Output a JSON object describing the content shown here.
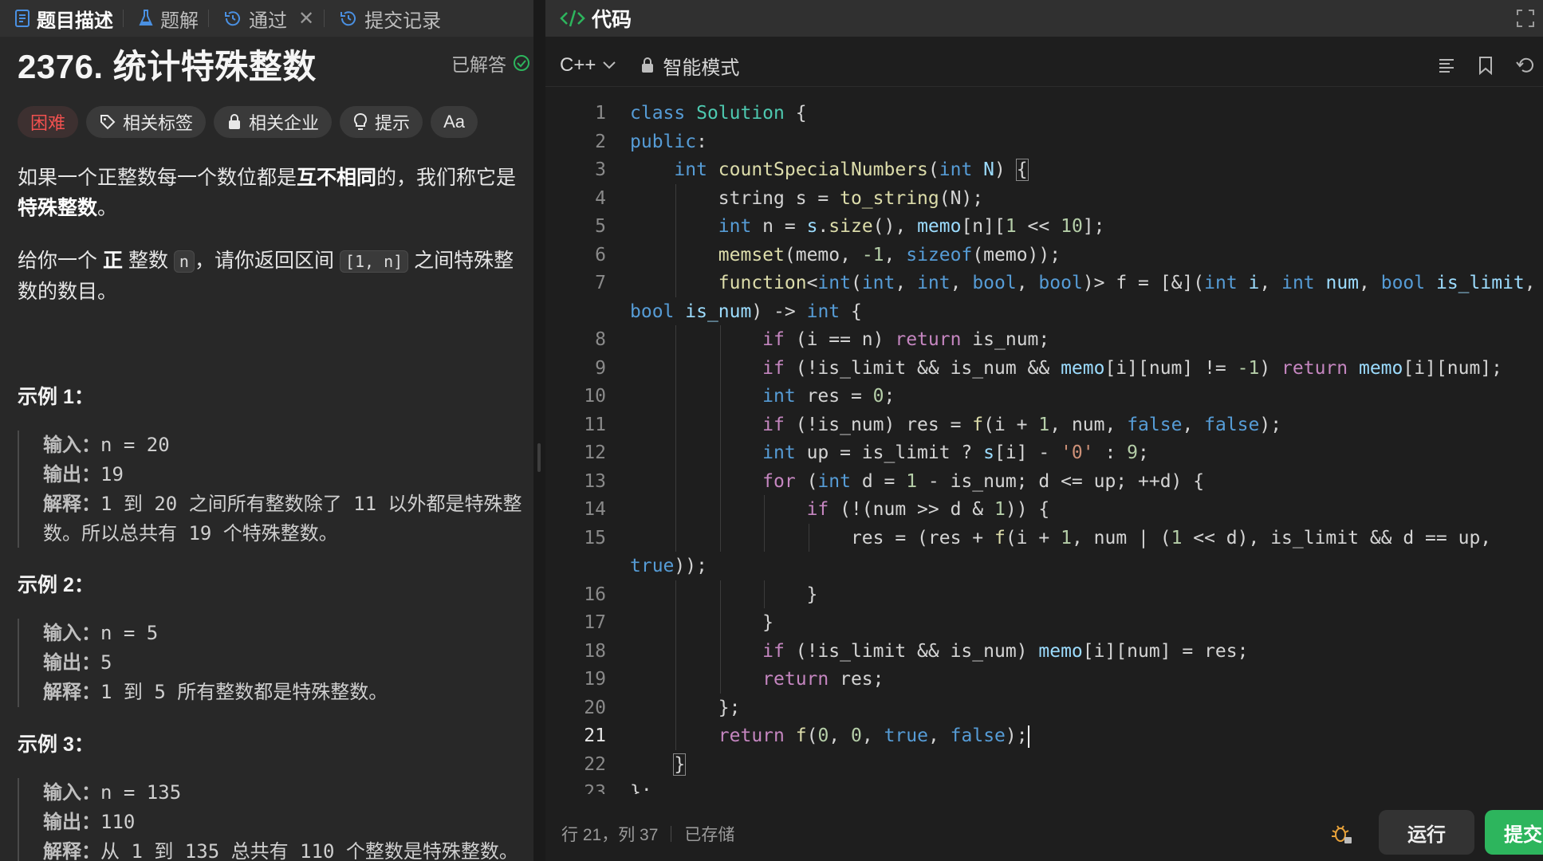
{
  "left_tabs": [
    {
      "label": "题目描述",
      "icon": "document-icon",
      "active": true
    },
    {
      "label": "题解",
      "icon": "flask-icon",
      "active": false
    },
    {
      "label": "通过",
      "icon": "history-icon",
      "active": false,
      "closable": true
    },
    {
      "label": "提交记录",
      "icon": "history-icon",
      "active": false
    }
  ],
  "problem": {
    "title": "2376. 统计特殊整数",
    "solved_label": "已解答",
    "difficulty": "困难",
    "chips": [
      "相关标签",
      "相关企业",
      "提示",
      "Aa"
    ],
    "desc1_a": "如果一个正整数每一个数位都是",
    "desc1_b": "互不相同",
    "desc1_c": "的，我们称它是",
    "desc1_d": "特殊整数",
    "desc1_e": "。",
    "desc2_a": "给你一个",
    "desc2_b": "正",
    "desc2_c": "整数",
    "desc2_n": "n",
    "desc2_d": "，请你返回区间",
    "desc2_range": "[1, n]",
    "desc2_e": "之间特殊整数的数目。"
  },
  "examples": [
    {
      "title": "示例 1：",
      "input_key": "输入：",
      "input": "n = 20",
      "output_key": "输出：",
      "output": "19",
      "expl_key": "解释：",
      "explanation": "1 到 20 之间所有整数除了 11 以外都是特殊整数。所以总共有 19 个特殊整数。"
    },
    {
      "title": "示例 2：",
      "input_key": "输入：",
      "input": "n = 5",
      "output_key": "输出：",
      "output": "5",
      "expl_key": "解释：",
      "explanation": "1 到 5 所有整数都是特殊整数。"
    },
    {
      "title": "示例 3：",
      "input_key": "输入：",
      "input": "n = 135",
      "output_key": "输出：",
      "output": "110",
      "expl_key": "解释：",
      "explanation": "从 1 到 135 总共有 110 个整数是特殊整数。"
    }
  ],
  "editor": {
    "tab_label": "代码",
    "language": "C++",
    "mode": "智能模式",
    "cursor_position": "行 21，列 37",
    "save_status": "已存储",
    "run_label": "运行",
    "submit_label": "提交"
  },
  "code_lines": [
    {
      "n": "1",
      "t": [
        [
          "kw",
          "class "
        ],
        [
          "cls",
          "Solution"
        ],
        [
          "pl",
          " {"
        ]
      ]
    },
    {
      "n": "2",
      "t": [
        [
          "kw",
          "public"
        ],
        [
          "pl",
          ":"
        ]
      ]
    },
    {
      "n": "3",
      "t": [
        [
          "pl",
          "    "
        ],
        [
          "kw",
          "int "
        ],
        [
          "fn",
          "countSpecialNumbers"
        ],
        [
          "pl",
          "("
        ],
        [
          "kw",
          "int "
        ],
        [
          "var",
          "N"
        ],
        [
          "pl",
          ") "
        ],
        [
          "hl",
          "{"
        ]
      ]
    },
    {
      "n": "4",
      "t": [
        [
          "pl",
          "        string s = "
        ],
        [
          "fn",
          "to_string"
        ],
        [
          "pl",
          "(N);"
        ]
      ]
    },
    {
      "n": "5",
      "t": [
        [
          "pl",
          "        "
        ],
        [
          "kw",
          "int "
        ],
        [
          "pl",
          "n = "
        ],
        [
          "var",
          "s"
        ],
        [
          "pl",
          "."
        ],
        [
          "fn",
          "size"
        ],
        [
          "pl",
          "(), "
        ],
        [
          "var",
          "memo"
        ],
        [
          "pl",
          "[n]["
        ],
        [
          "num",
          "1"
        ],
        [
          "pl",
          " << "
        ],
        [
          "num",
          "10"
        ],
        [
          "pl",
          "];"
        ]
      ]
    },
    {
      "n": "6",
      "t": [
        [
          "pl",
          "        "
        ],
        [
          "fn",
          "memset"
        ],
        [
          "pl",
          "(memo, "
        ],
        [
          "num",
          "-1"
        ],
        [
          "pl",
          ", "
        ],
        [
          "kw",
          "sizeof"
        ],
        [
          "pl",
          "(memo));"
        ]
      ]
    },
    {
      "n": "7",
      "t": [
        [
          "pl",
          "        "
        ],
        [
          "fn",
          "function"
        ],
        [
          "pl",
          "<"
        ],
        [
          "kw",
          "int"
        ],
        [
          "pl",
          "("
        ],
        [
          "kw",
          "int"
        ],
        [
          "pl",
          ", "
        ],
        [
          "kw",
          "int"
        ],
        [
          "pl",
          ", "
        ],
        [
          "kw",
          "bool"
        ],
        [
          "pl",
          ", "
        ],
        [
          "kw",
          "bool"
        ],
        [
          "pl",
          ")> f = [&]("
        ],
        [
          "kw",
          "int "
        ],
        [
          "var",
          "i"
        ],
        [
          "pl",
          ", "
        ],
        [
          "kw",
          "int "
        ],
        [
          "var",
          "num"
        ],
        [
          "pl",
          ", "
        ],
        [
          "kw",
          "bool "
        ],
        [
          "var",
          "is_limit"
        ],
        [
          "pl",
          ","
        ]
      ]
    },
    {
      "n": "",
      "t": [
        [
          "kw",
          "bool "
        ],
        [
          "var",
          "is_num"
        ],
        [
          "pl",
          ") -> "
        ],
        [
          "kw",
          "int"
        ],
        [
          "pl",
          " {"
        ]
      ]
    },
    {
      "n": "8",
      "t": [
        [
          "pl",
          "            "
        ],
        [
          "ctl",
          "if"
        ],
        [
          "pl",
          " (i == n) "
        ],
        [
          "ctl",
          "return"
        ],
        [
          "pl",
          " is_num;"
        ]
      ]
    },
    {
      "n": "9",
      "t": [
        [
          "pl",
          "            "
        ],
        [
          "ctl",
          "if"
        ],
        [
          "pl",
          " (!is_limit && is_num && "
        ],
        [
          "var",
          "memo"
        ],
        [
          "pl",
          "[i][num] != "
        ],
        [
          "num",
          "-1"
        ],
        [
          "pl",
          ") "
        ],
        [
          "ctl",
          "return "
        ],
        [
          "var",
          "memo"
        ],
        [
          "pl",
          "[i][num];"
        ]
      ]
    },
    {
      "n": "10",
      "t": [
        [
          "pl",
          "            "
        ],
        [
          "kw",
          "int "
        ],
        [
          "pl",
          "res = "
        ],
        [
          "num",
          "0"
        ],
        [
          "pl",
          ";"
        ]
      ]
    },
    {
      "n": "11",
      "t": [
        [
          "pl",
          "            "
        ],
        [
          "ctl",
          "if"
        ],
        [
          "pl",
          " (!is_num) res = "
        ],
        [
          "fn",
          "f"
        ],
        [
          "pl",
          "(i + "
        ],
        [
          "num",
          "1"
        ],
        [
          "pl",
          ", num, "
        ],
        [
          "kw",
          "false"
        ],
        [
          "pl",
          ", "
        ],
        [
          "kw",
          "false"
        ],
        [
          "pl",
          ");"
        ]
      ]
    },
    {
      "n": "12",
      "t": [
        [
          "pl",
          "            "
        ],
        [
          "kw",
          "int "
        ],
        [
          "pl",
          "up = is_limit ? "
        ],
        [
          "var",
          "s"
        ],
        [
          "pl",
          "[i] - "
        ],
        [
          "str",
          "'0'"
        ],
        [
          "pl",
          " : "
        ],
        [
          "num",
          "9"
        ],
        [
          "pl",
          ";"
        ]
      ]
    },
    {
      "n": "13",
      "t": [
        [
          "pl",
          "            "
        ],
        [
          "ctl",
          "for"
        ],
        [
          "pl",
          " ("
        ],
        [
          "kw",
          "int "
        ],
        [
          "pl",
          "d = "
        ],
        [
          "num",
          "1"
        ],
        [
          "pl",
          " - is_num; d <= up; ++d) {"
        ]
      ]
    },
    {
      "n": "14",
      "t": [
        [
          "pl",
          "                "
        ],
        [
          "ctl",
          "if"
        ],
        [
          "pl",
          " (!(num >> d & "
        ],
        [
          "num",
          "1"
        ],
        [
          "pl",
          ")) {"
        ]
      ]
    },
    {
      "n": "15",
      "t": [
        [
          "pl",
          "                    res = (res + "
        ],
        [
          "fn",
          "f"
        ],
        [
          "pl",
          "(i + "
        ],
        [
          "num",
          "1"
        ],
        [
          "pl",
          ", num | ("
        ],
        [
          "num",
          "1"
        ],
        [
          "pl",
          " << d), is_limit && d == up,"
        ]
      ]
    },
    {
      "n": "",
      "t": [
        [
          "kw",
          "true"
        ],
        [
          "pl",
          "));"
        ]
      ]
    },
    {
      "n": "16",
      "t": [
        [
          "pl",
          "                }"
        ]
      ]
    },
    {
      "n": "17",
      "t": [
        [
          "pl",
          "            }"
        ]
      ]
    },
    {
      "n": "18",
      "t": [
        [
          "pl",
          "            "
        ],
        [
          "ctl",
          "if"
        ],
        [
          "pl",
          " (!is_limit && is_num) "
        ],
        [
          "var",
          "memo"
        ],
        [
          "pl",
          "[i][num] = res;"
        ]
      ]
    },
    {
      "n": "19",
      "t": [
        [
          "pl",
          "            "
        ],
        [
          "ctl",
          "return"
        ],
        [
          "pl",
          " res;"
        ]
      ]
    },
    {
      "n": "20",
      "t": [
        [
          "pl",
          "        };"
        ]
      ]
    },
    {
      "n": "21",
      "t": [
        [
          "pl",
          "        "
        ],
        [
          "ctl",
          "return "
        ],
        [
          "fn",
          "f"
        ],
        [
          "pl",
          "("
        ],
        [
          "num",
          "0"
        ],
        [
          "pl",
          ", "
        ],
        [
          "num",
          "0"
        ],
        [
          "pl",
          ", "
        ],
        [
          "kw",
          "true"
        ],
        [
          "pl",
          ", "
        ],
        [
          "kw",
          "false"
        ],
        [
          "pl",
          ");"
        ],
        [
          "caret",
          ""
        ]
      ]
    },
    {
      "n": "22",
      "t": [
        [
          "pl",
          "    "
        ],
        [
          "hl",
          "}"
        ]
      ]
    },
    {
      "n": "23",
      "t": [
        [
          "pl",
          "};"
        ]
      ]
    }
  ],
  "colors": {
    "accent_green": "#2db55d",
    "difficulty_red": "#f0514f"
  }
}
